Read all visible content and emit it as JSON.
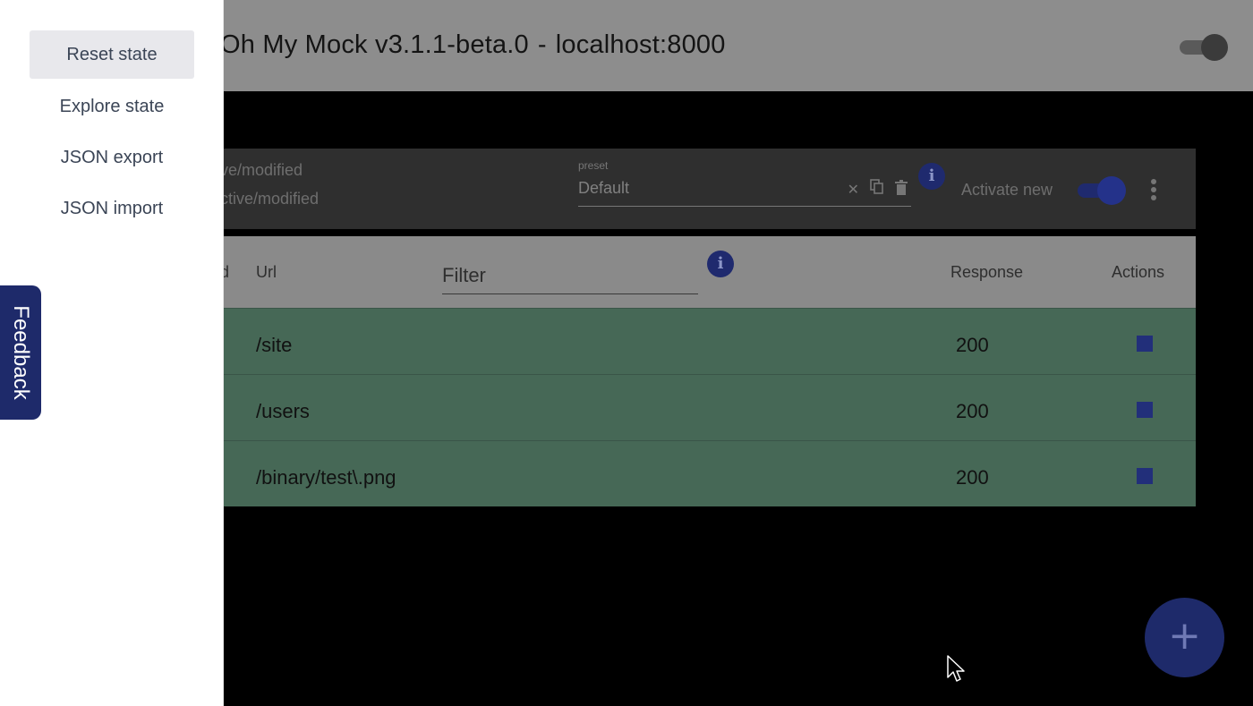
{
  "toolbar": {
    "app_name": "Oh My Mock v3.1.1-beta.0",
    "separator": "-",
    "host": "localhost:8000",
    "toggle_state": "on"
  },
  "preset_bar": {
    "status_line_1": "ve/modified",
    "status_line_2": "ctive/modified",
    "preset_label": "preset",
    "preset_value": "Default",
    "activate_new_label": "Activate new",
    "activate_new_state": "on"
  },
  "table": {
    "headers": {
      "method": "d",
      "url": "Url",
      "filter_placeholder": "Filter",
      "response": "Response",
      "actions": "Actions"
    },
    "rows": [
      {
        "url": "/site",
        "response": "200"
      },
      {
        "url": "/users",
        "response": "200"
      },
      {
        "url": "/binary/test\\.png",
        "response": "200"
      }
    ]
  },
  "drawer": {
    "items": [
      {
        "label": "Reset state"
      },
      {
        "label": "Explore state"
      },
      {
        "label": "JSON export"
      },
      {
        "label": "JSON import"
      }
    ]
  },
  "feedback": {
    "label": "Feedback"
  },
  "fab": {
    "icon": "+"
  },
  "icons": {
    "info": "i",
    "clear": "✕",
    "copy": "⧉",
    "delete": "🗑"
  },
  "colors": {
    "accent": "#1e2a6a",
    "row_active": "#466856",
    "drawer_bg": "#ffffff"
  }
}
